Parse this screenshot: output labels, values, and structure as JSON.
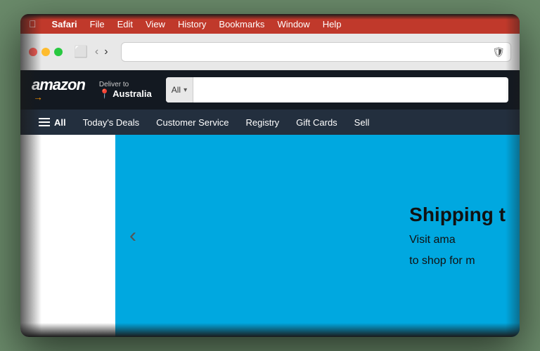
{
  "menubar": {
    "apple": "⌘",
    "items": [
      "Safari",
      "File",
      "Edit",
      "View",
      "History",
      "Bookmarks",
      "Window",
      "Help"
    ]
  },
  "browser": {
    "address_placeholder": "",
    "shield_icon": "🛡",
    "nav_prev": "‹",
    "nav_next": "›",
    "sidebar_icon": "⬜"
  },
  "amazon": {
    "logo_text": "amazon",
    "logo_arrow": "↗",
    "deliver_label": "Deliver to",
    "deliver_location": "Australia",
    "location_pin": "📍",
    "search_category": "All",
    "nav_items": [
      {
        "id": "all",
        "label": "All"
      },
      {
        "id": "todays-deals",
        "label": "Today's Deals"
      },
      {
        "id": "customer-service",
        "label": "Customer Service"
      },
      {
        "id": "registry",
        "label": "Registry"
      },
      {
        "id": "gift-cards",
        "label": "Gift Cards"
      },
      {
        "id": "sell",
        "label": "Sell"
      }
    ]
  },
  "hero": {
    "title": "Shipping t",
    "subtitle_line1": "Visit ama",
    "subtitle_line2": "to shop for m",
    "carousel_arrow": "‹",
    "bg_color": "#00a8e0"
  },
  "colors": {
    "menubar_red": "#c0392b",
    "amazon_dark": "#131921",
    "amazon_nav": "#232f3e",
    "amazon_orange": "#ff9900"
  }
}
